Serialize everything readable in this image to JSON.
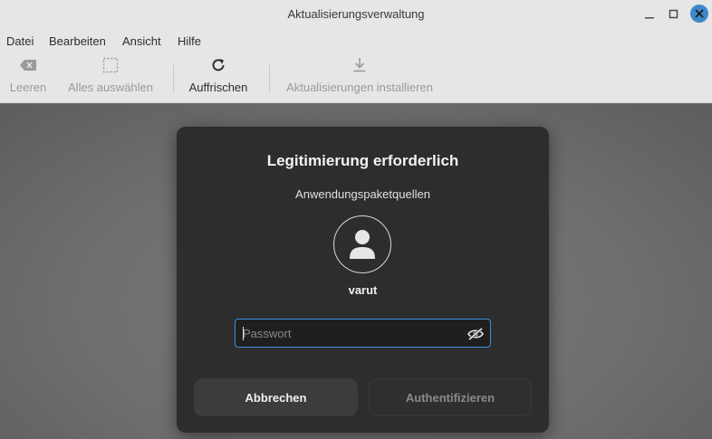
{
  "window": {
    "title": "Aktualisierungsverwaltung"
  },
  "menu": [
    "Datei",
    "Bearbeiten",
    "Ansicht",
    "Hilfe"
  ],
  "toolbar": {
    "clear": {
      "label": "Leeren",
      "icon": "backspace-icon"
    },
    "select_all": {
      "label": "Alles auswählen",
      "icon": "select-all-icon"
    },
    "refresh": {
      "label": "Auffrischen",
      "icon": "refresh-icon"
    },
    "install": {
      "label": "Aktualisierungen installieren",
      "icon": "download-icon"
    }
  },
  "dialog": {
    "title": "Legitimierung erforderlich",
    "subtitle": "Anwendungspaketquellen",
    "username": "varut",
    "password": {
      "placeholder": "Passwort",
      "value": ""
    },
    "cancel_label": "Abbrechen",
    "auth_label": "Authentifizieren"
  },
  "colors": {
    "accent": "#3e87c9",
    "focus_border": "#3d8fe0",
    "dialog_bg": "#2d2d2d"
  }
}
